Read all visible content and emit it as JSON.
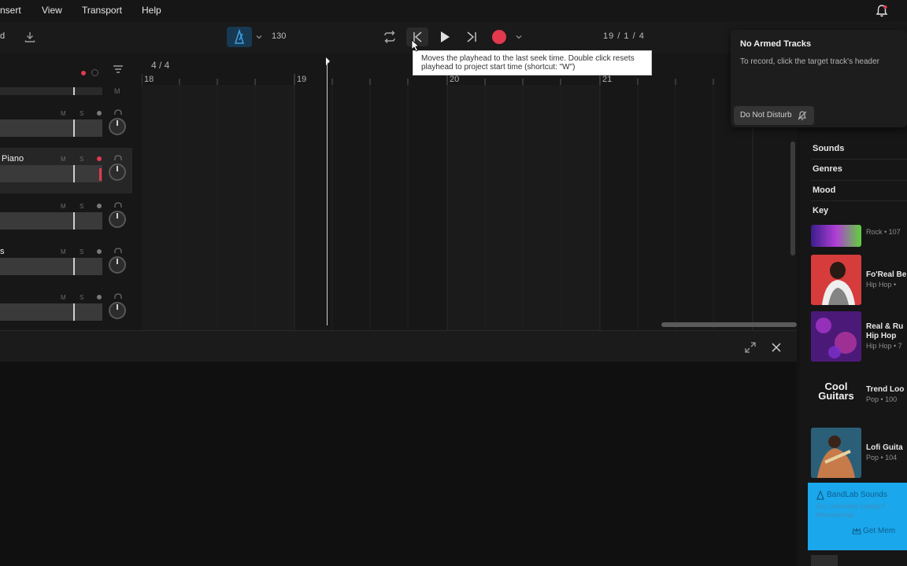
{
  "menu": {
    "items": [
      {
        "label": "nsert"
      },
      {
        "label": "View"
      },
      {
        "label": "Transport"
      },
      {
        "label": "Help"
      }
    ]
  },
  "toolbar": {
    "left_label": "d",
    "tempo": "130",
    "position": "19 / 1 / 4",
    "tooltip": "Moves the playhead to the last seek time. Double click resets playhead to project start time (shortcut: \"W\")"
  },
  "timeline": {
    "time_signature": "4 / 4",
    "bars": [
      "18",
      "19",
      "20",
      "21"
    ]
  },
  "tracks": [
    {
      "name": "",
      "selected": false
    },
    {
      "name": "Piano",
      "selected": true,
      "armed": true
    },
    {
      "name": "",
      "selected": false
    },
    {
      "name": "s",
      "selected": false
    },
    {
      "name": "",
      "selected": false
    }
  ],
  "track_controls": {
    "mute": "M",
    "solo": "S"
  },
  "notification": {
    "title": "No Armed Tracks",
    "body": "To record, click the target track's header",
    "dnd_label": "Do Not Disturb"
  },
  "sounds": {
    "filters": [
      "Sounds",
      "Genres",
      "Mood",
      "Key"
    ],
    "packs": [
      {
        "name": "",
        "meta": "Rock • 107"
      },
      {
        "name": "Fo'Real Be",
        "meta": "Hip Hop •"
      },
      {
        "name": "Real & Ru",
        "name2": "Hip Hop",
        "meta": "Hip Hop • 7"
      },
      {
        "name": "Trend Loo",
        "meta": "Pop • 100"
      },
      {
        "name": "Lofi Guita",
        "meta": "Pop • 104"
      }
    ],
    "art_text": {
      "cool_guitars": "Cool Guitars"
    },
    "promo": {
      "title": "BandLab Sounds",
      "body_line1": "Get unlimited royalty-f",
      "body_line2": "Membership",
      "cta": "Get Mem"
    }
  },
  "colors": {
    "record": "#e2394e",
    "metronome_active": "#1b4a6b",
    "promo": "#1aa7ec"
  }
}
